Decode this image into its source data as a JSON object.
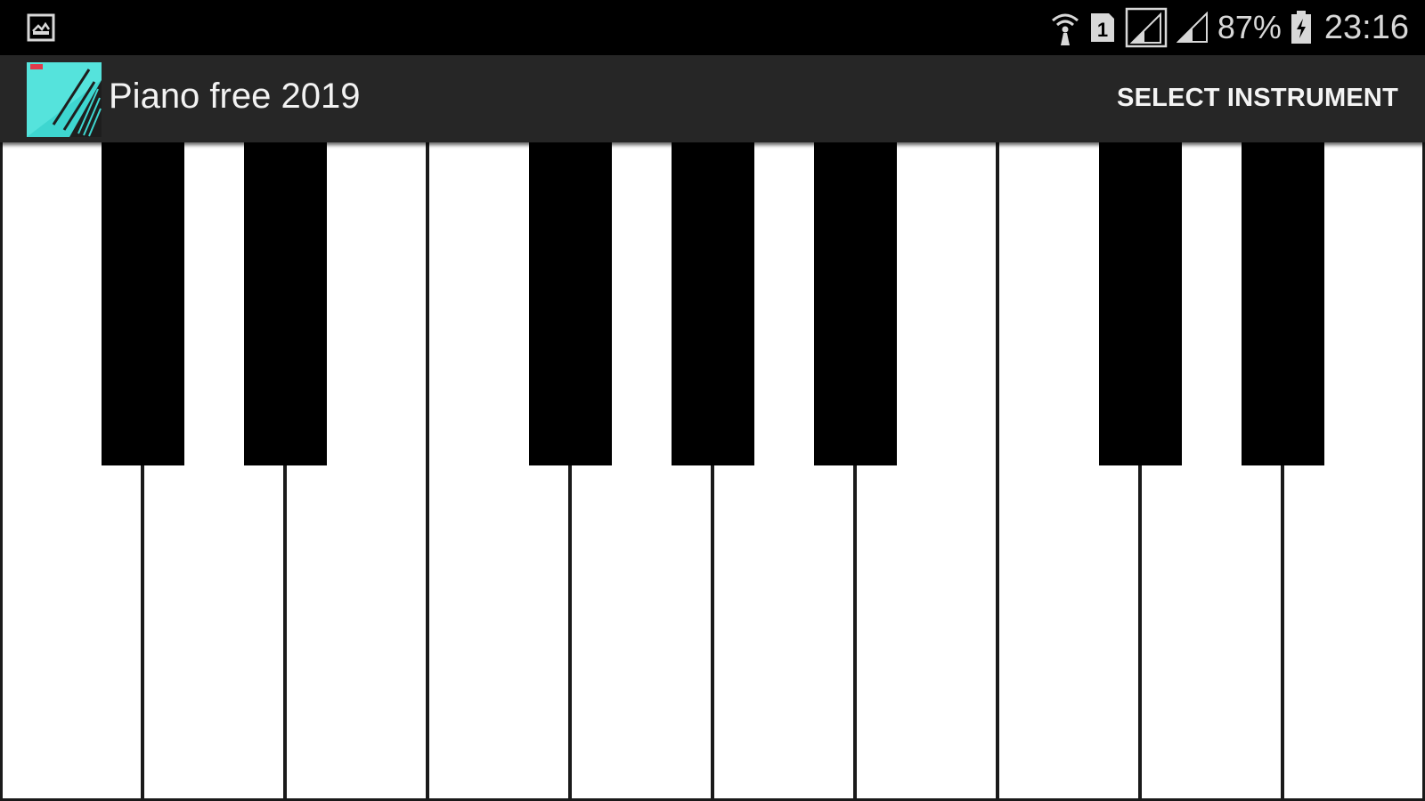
{
  "status_bar": {
    "left_icon": "gallery-notification-icon",
    "icons": [
      "wifi-icon",
      "sim-1-icon",
      "cell-signal-box-icon",
      "cell-signal-icon",
      "battery-charging-icon"
    ],
    "battery_percent": "87%",
    "time": "23:16"
  },
  "app_bar": {
    "title": "Piano free 2019",
    "icon": "piano-app-icon",
    "action_label": "SELECT INSTRUMENT"
  },
  "keyboard": {
    "white_key_count": 10,
    "black_key_groups": [
      2,
      3,
      2
    ]
  },
  "colors": {
    "status_bar_bg": "#000000",
    "app_bar_bg": "#262626",
    "white_key": "#ffffff",
    "black_key": "#000000",
    "key_separator": "#1a1a1a",
    "icon_accent": "#3ed6d0"
  }
}
